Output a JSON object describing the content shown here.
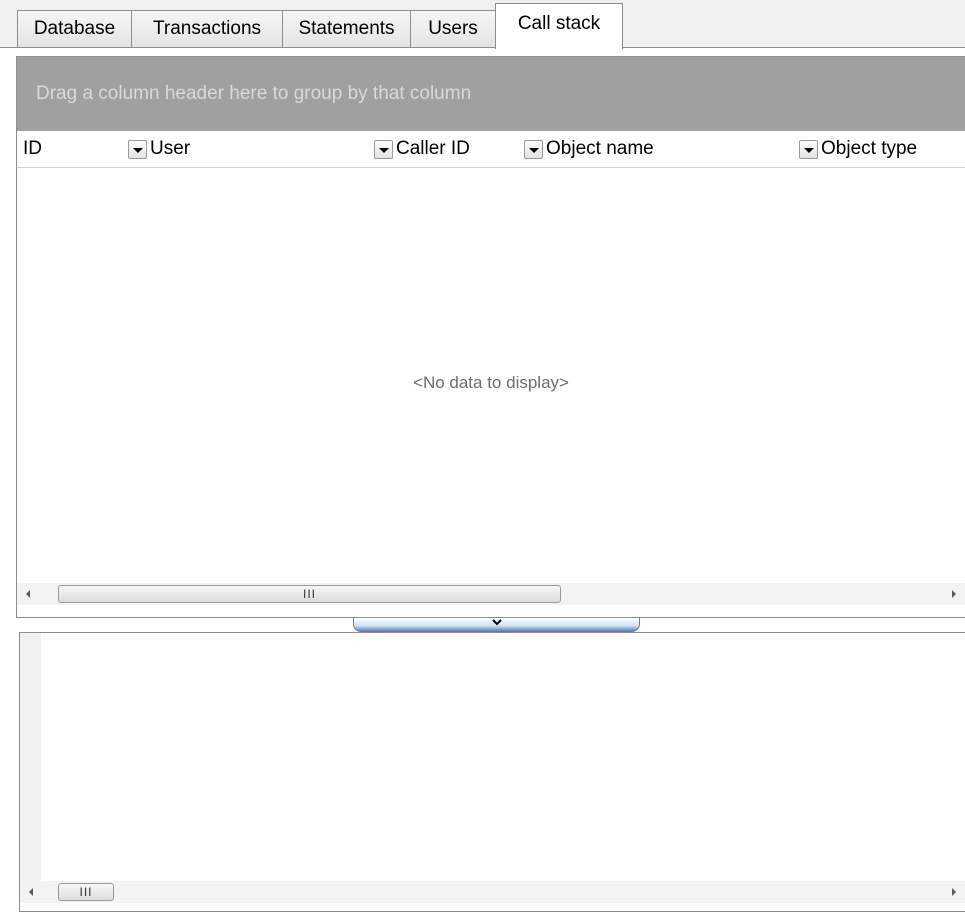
{
  "tabs": [
    {
      "label": "Database",
      "active": false
    },
    {
      "label": "Transactions",
      "active": false
    },
    {
      "label": "Statements",
      "active": false
    },
    {
      "label": "Users",
      "active": false
    },
    {
      "label": "Call stack",
      "active": true
    }
  ],
  "grid": {
    "group_panel_text": "Drag a column header here to group by that column",
    "columns": [
      "ID",
      "User",
      "Caller ID",
      "Object name",
      "Object type"
    ],
    "empty_text": "<No data to display>",
    "scroll_thumb_grip": "III"
  },
  "detail": {
    "scroll_thumb_grip": "III"
  },
  "colors": {
    "group_panel_bg": "#a0a0a0",
    "splitter_accent": "#5d86b8"
  }
}
